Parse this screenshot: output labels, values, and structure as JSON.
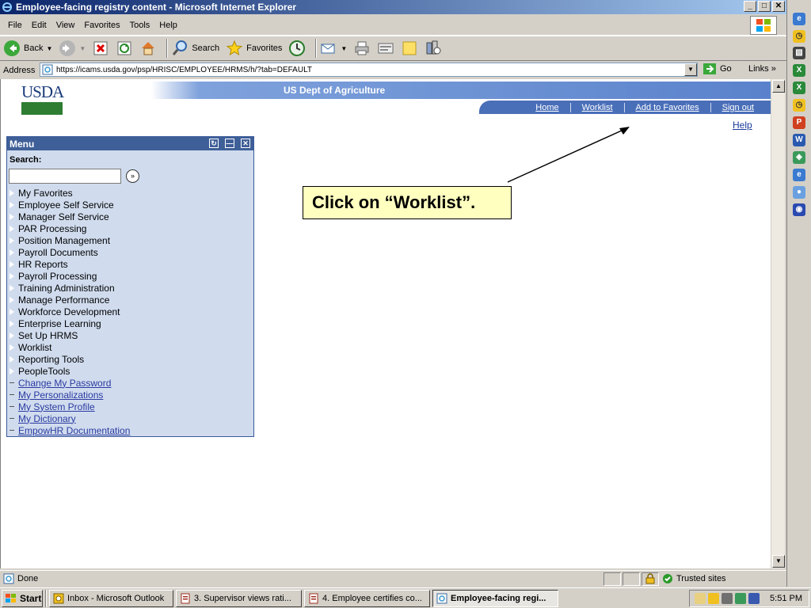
{
  "window": {
    "title": "Employee-facing registry content - Microsoft Internet Explorer",
    "controls": [
      "_",
      "□",
      "✕"
    ]
  },
  "menubar": [
    "File",
    "Edit",
    "View",
    "Favorites",
    "Tools",
    "Help"
  ],
  "toolbar": {
    "back": "Back",
    "search": "Search",
    "favorites": "Favorites"
  },
  "address": {
    "label": "Address",
    "url": "https://icams.usda.gov/psp/HRISC/EMPLOYEE/HRMS/h/?tab=DEFAULT",
    "go": "Go",
    "links": "Links"
  },
  "header": {
    "logo": "USDA",
    "title": "US Dept of Agriculture",
    "nav": [
      "Home",
      "Worklist",
      "Add to Favorites",
      "Sign out"
    ],
    "help": "Help"
  },
  "menu": {
    "title": "Menu",
    "search_label": "Search:",
    "items": [
      "My Favorites",
      "Employee Self Service",
      "Manager Self Service",
      "PAR Processing",
      "Position Management",
      "Payroll Documents",
      "HR Reports",
      "Payroll Processing",
      "Training Administration",
      "Manage Performance",
      "Workforce Development",
      "Enterprise Learning",
      "Set Up HRMS",
      "Worklist",
      "Reporting Tools",
      "PeopleTools"
    ],
    "links": [
      "Change My Password",
      "My Personalizations",
      "My System Profile",
      "My Dictionary",
      "EmpowHR Documentation"
    ]
  },
  "callout": {
    "text": "Click on “Worklist”."
  },
  "status": {
    "text": "Done",
    "zone": "Trusted sites"
  },
  "taskbar": {
    "start": "Start",
    "tasks": [
      "Inbox - Microsoft Outlook",
      "3.  Supervisor views rati...",
      "4.  Employee certifies co...",
      "Employee-facing regi..."
    ],
    "clock": "5:51 PM"
  },
  "colors": {
    "title_bar": "#0a246a",
    "portlet_header": "#3f5f98",
    "portlet_body": "#d0dcee",
    "nav_band": "#4a6fb9",
    "callout_bg": "#ffffc0"
  }
}
